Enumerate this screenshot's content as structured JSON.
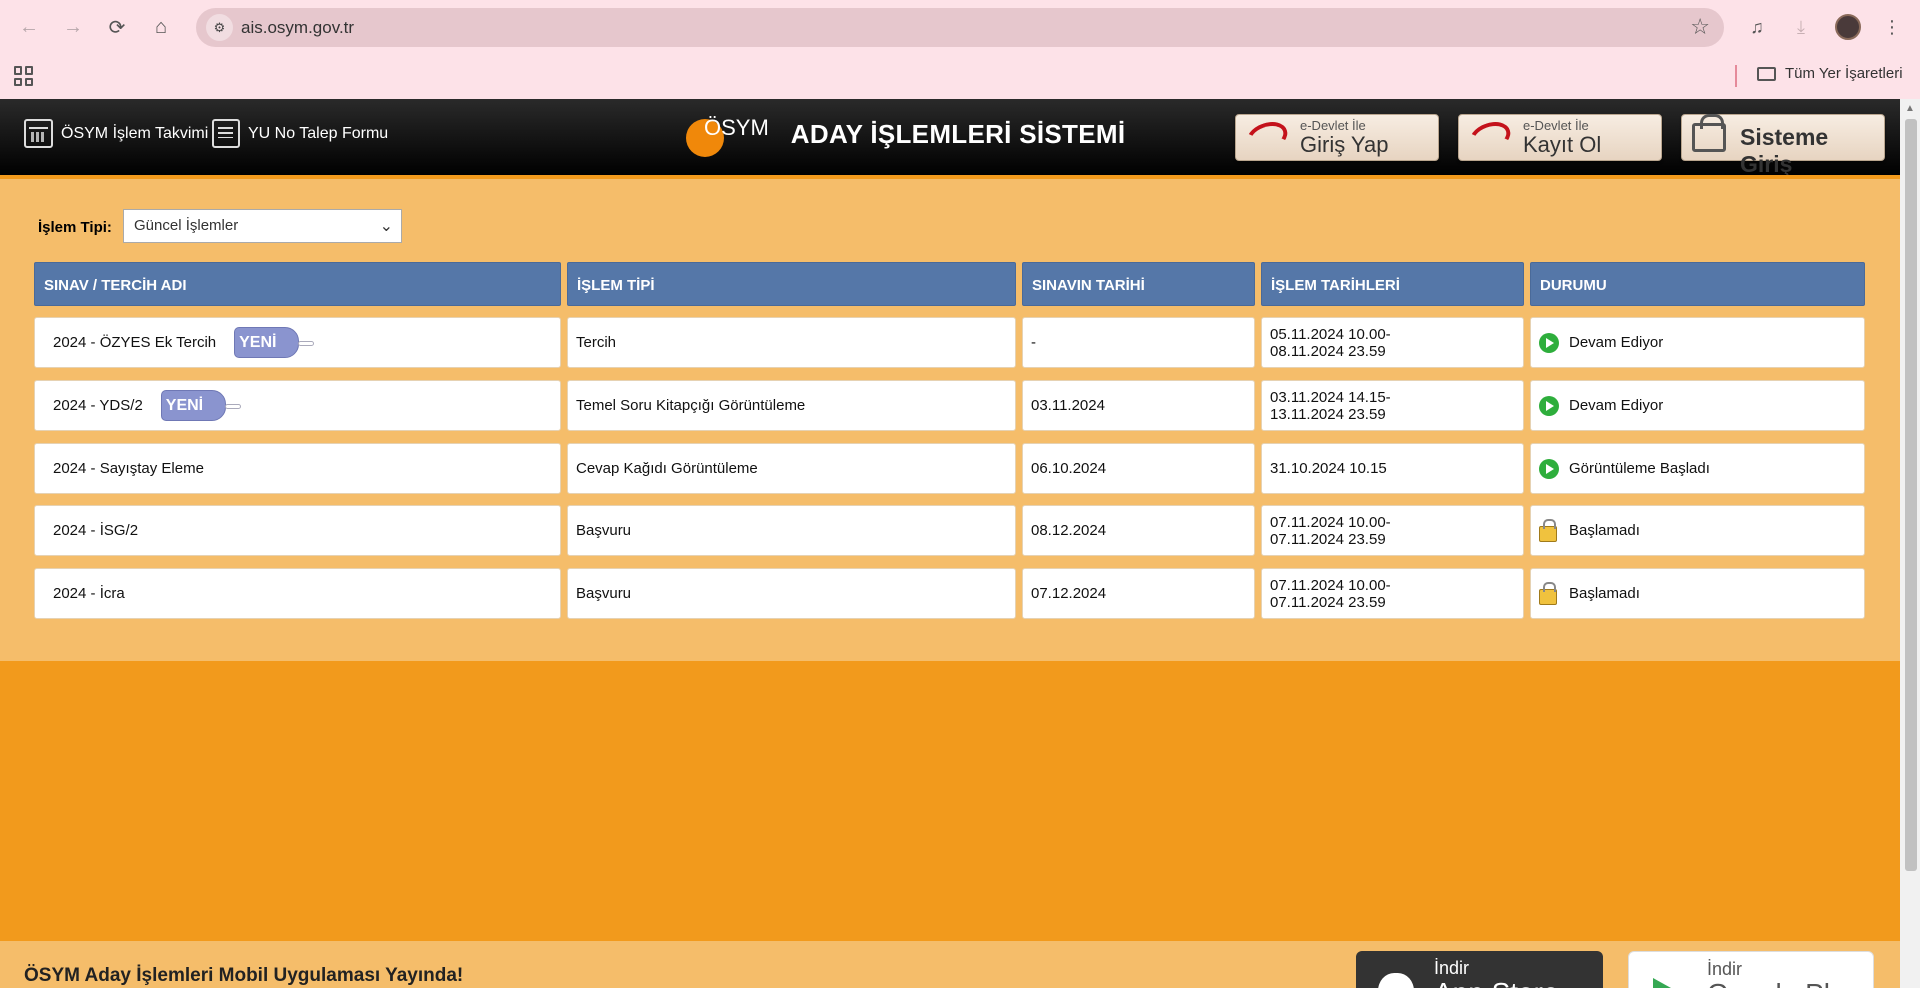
{
  "browser": {
    "url": "ais.osym.gov.tr",
    "bookmark_folder": "Tüm Yer İşaretleri"
  },
  "header": {
    "calendar_link": "ÖSYM İşlem Takvimi",
    "yu_link": "YU No Talep Formu",
    "logo_text": "ÖSYM",
    "title": "ADAY İŞLEMLERİ SİSTEMİ",
    "edevlet_login": {
      "small": "e-Devlet İle",
      "large": "Giriş Yap"
    },
    "edevlet_register": {
      "small": "e-Devlet İle",
      "large": "Kayıt Ol"
    },
    "system_login": "Sisteme Giriş"
  },
  "filter": {
    "label": "İşlem Tipi:",
    "selected": "Güncel İşlemler"
  },
  "table": {
    "headers": [
      "SINAV / TERCİH ADI",
      "İŞLEM TİPİ",
      "SINAVIN TARİHİ",
      "İŞLEM TARİHLERİ",
      "DURUMU"
    ],
    "badge_text": "YENİ",
    "rows": [
      {
        "name": "2024 - ÖZYES Ek Tercih",
        "is_new": true,
        "type": "Tercih",
        "exam_date": "-",
        "dates_1": "05.11.2024 10.00-",
        "dates_2": "08.11.2024 23.59",
        "status": "Devam Ediyor",
        "status_icon": "play-icon"
      },
      {
        "name": "2024 - YDS/2",
        "is_new": true,
        "type": "Temel Soru Kitapçığı Görüntüleme",
        "exam_date": "03.11.2024",
        "dates_1": "03.11.2024 14.15-",
        "dates_2": "13.11.2024 23.59",
        "status": "Devam Ediyor",
        "status_icon": "play-icon"
      },
      {
        "name": "2024 - Sayıştay Eleme",
        "is_new": false,
        "type": "Cevap Kağıdı Görüntüleme",
        "exam_date": "06.10.2024",
        "dates_1": "31.10.2024 10.15",
        "dates_2": "",
        "status": "Görüntüleme Başladı",
        "status_icon": "play-icon"
      },
      {
        "name": "2024 - İSG/2",
        "is_new": false,
        "type": "Başvuru",
        "exam_date": "08.12.2024",
        "dates_1": "07.11.2024 10.00-",
        "dates_2": "07.11.2024 23.59",
        "status": "Başlamadı",
        "status_icon": "lock-icon"
      },
      {
        "name": "2024 - İcra",
        "is_new": false,
        "type": "Başvuru",
        "exam_date": "07.12.2024",
        "dates_1": "07.11.2024 10.00-",
        "dates_2": "07.11.2024 23.59",
        "status": "Başlamadı",
        "status_icon": "lock-icon"
      }
    ]
  },
  "footer": {
    "text": "ÖSYM Aday İşlemleri Mobil Uygulaması Yayında!",
    "app_store": {
      "small": "İndir",
      "large": "App Store"
    },
    "google_play": {
      "small": "İndir",
      "large": "Google Play"
    }
  }
}
